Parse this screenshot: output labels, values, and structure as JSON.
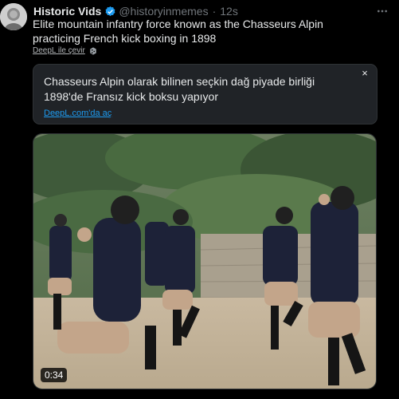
{
  "author": {
    "display_name": "Historic Vids",
    "handle": "@historyinmemes",
    "separator": "·",
    "time": "12s"
  },
  "tweet": {
    "text": "Elite mountain infantry force known as the Chasseurs Alpin practicing French kick boxing in 1898"
  },
  "translate": {
    "label": "DeepL ile çevir"
  },
  "translation_card": {
    "text": "Chasseurs Alpin olarak bilinen seçkin dağ piyade birliği 1898'de Fransız kick boksu yapıyor",
    "link": "DeepL.com'da aç",
    "close": "×"
  },
  "media": {
    "duration": "0:34"
  },
  "icons": {
    "verified": "verified-badge-icon",
    "more": "more-horizontal-icon",
    "deepl": "deepl-icon",
    "close": "close-icon"
  },
  "colors": {
    "background": "#000000",
    "text": "#e7e9ea",
    "muted": "#71767b",
    "link": "#1d9bf0",
    "card": "#202327"
  }
}
